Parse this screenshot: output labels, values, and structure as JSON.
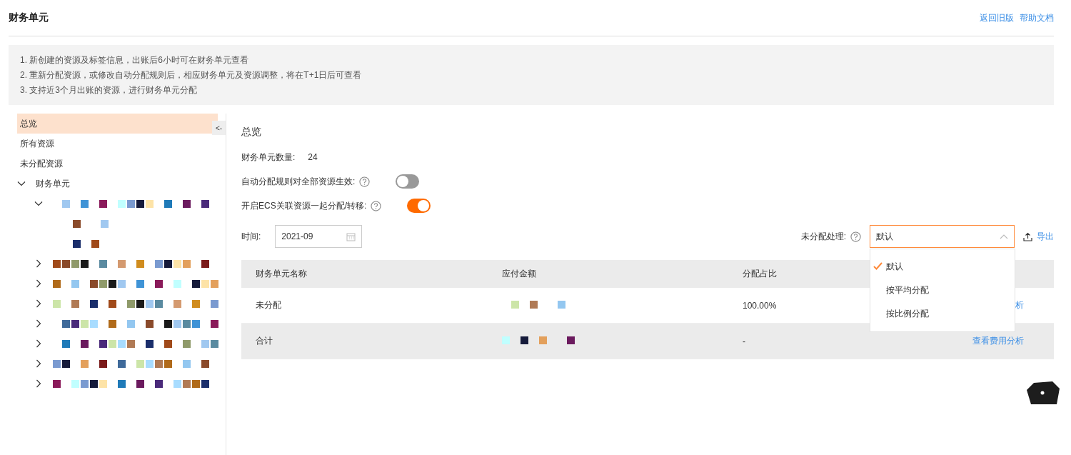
{
  "page": {
    "title": "财务单元",
    "links": [
      {
        "label": "返回旧版"
      },
      {
        "label": "帮助文档"
      }
    ]
  },
  "notice": {
    "lines": [
      "1. 新创建的资源及标签信息，出账后6小时可在财务单元查看",
      "2. 重新分配资源，或修改自动分配规则后，相应财务单元及资源调整，将在T+1日后可查看",
      "3. 支持近3个月出账的资源，进行财务单元分配"
    ]
  },
  "sidebar": {
    "collapse_button": "<-",
    "items": [
      {
        "label": "总览",
        "selected": true
      },
      {
        "label": "所有资源",
        "selected": false
      },
      {
        "label": "未分配资源",
        "selected": false
      }
    ],
    "tree": {
      "label": "财务单元",
      "expanded": true,
      "children": [
        {
          "kind": "redacted",
          "expanded": true,
          "children": [
            {
              "kind": "redacted"
            },
            {
              "kind": "redacted"
            }
          ]
        },
        {
          "kind": "redacted",
          "expanded": false
        },
        {
          "kind": "redacted",
          "expanded": false
        },
        {
          "kind": "redacted",
          "expanded": false
        },
        {
          "kind": "redacted",
          "expanded": false
        },
        {
          "kind": "redacted",
          "expanded": false
        },
        {
          "kind": "redacted",
          "expanded": false
        },
        {
          "kind": "redacted",
          "expanded": false
        }
      ]
    }
  },
  "main": {
    "title": "总览",
    "stats": [
      {
        "label": "财务单元数量:",
        "value": "24"
      }
    ],
    "settings": [
      {
        "label": "自动分配规则对全部资源生效:",
        "on": false
      },
      {
        "label": "开启ECS关联资源一起分配/转移:",
        "on": true
      }
    ],
    "time": {
      "label": "时间:",
      "value": "2021-09"
    },
    "unallocated": {
      "label": "未分配处理:",
      "value": "默认",
      "expanded": true,
      "options": [
        {
          "label": "默认",
          "selected": true
        },
        {
          "label": "按平均分配",
          "selected": false
        },
        {
          "label": "按比例分配",
          "selected": false
        }
      ]
    },
    "export": "导出",
    "table": {
      "columns": [
        "财务单元名称",
        "应付金额",
        "分配占比"
      ],
      "rows": [
        {
          "kind": "row",
          "name": "未分配",
          "amount": {
            "kind": "redacted"
          },
          "ratio": "100.00%",
          "action": "析"
        },
        {
          "kind": "total",
          "name": "合计",
          "amount": {
            "kind": "redacted"
          },
          "ratio": "-",
          "action": "查看费用分析"
        }
      ]
    }
  }
}
